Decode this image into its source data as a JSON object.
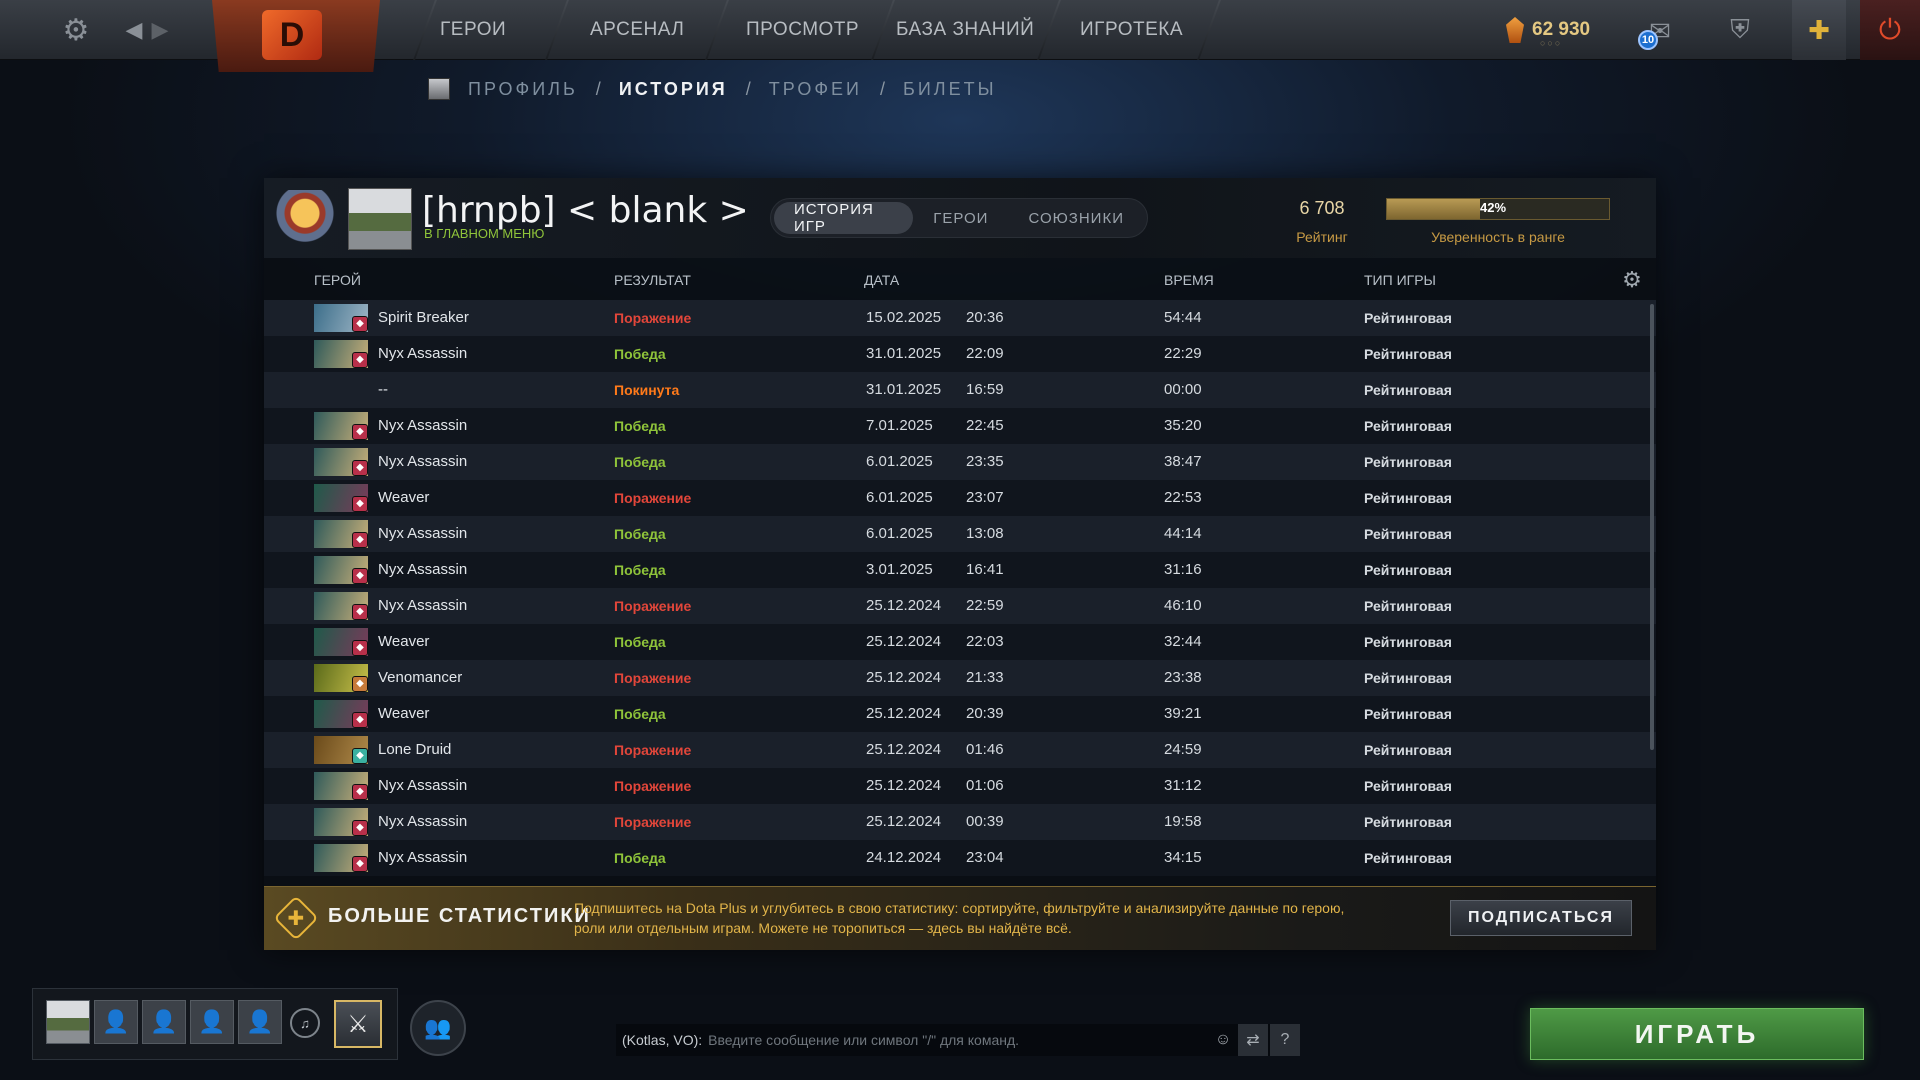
{
  "nav": {
    "items": [
      "ГЕРОИ",
      "АРСЕНАЛ",
      "ПРОСМОТР",
      "БАЗА ЗНАНИЙ",
      "ИГРОТЕКА"
    ],
    "logo_text": "D",
    "shards": "62 930",
    "shard_dots": "○○○",
    "mail_count": "10"
  },
  "subnav": {
    "items": [
      {
        "label": "ПРОФИЛЬ",
        "active": false
      },
      {
        "label": "ИСТОРИЯ",
        "active": true
      },
      {
        "label": "ТРОФЕИ",
        "active": false
      },
      {
        "label": "БИЛЕТЫ",
        "active": false
      }
    ],
    "separator": "/"
  },
  "profile": {
    "name": "[hrnpb] < blank >",
    "status": "В ГЛАВНОМ МЕНЮ",
    "rating_value": "6 708",
    "rating_label": "Рейтинг",
    "confidence_percent": 42,
    "confidence_text": "42%",
    "confidence_label": "Уверенность в ранге"
  },
  "tabs": [
    {
      "label": "ИСТОРИЯ ИГР",
      "active": true
    },
    {
      "label": "ГЕРОИ",
      "active": false
    },
    {
      "label": "СОЮЗНИКИ",
      "active": false
    }
  ],
  "table": {
    "headers": {
      "hero": "ГЕРОЙ",
      "result": "РЕЗУЛЬТАТ",
      "date": "ДАТА",
      "duration": "ВРЕМЯ",
      "mode": "ТИП ИГРЫ"
    },
    "rows": [
      {
        "hero": "Spirit Breaker",
        "result": "Поражение",
        "status": "loss",
        "date": "15.02.2025",
        "time": "20:36",
        "duration": "54:44",
        "mode": "Рейтинговая",
        "colors": [
          "#3c6e8a",
          "#9fb6c6"
        ],
        "role": "#b8304a"
      },
      {
        "hero": "Nyx Assassin",
        "result": "Победа",
        "status": "win",
        "date": "31.01.2025",
        "time": "22:09",
        "duration": "22:29",
        "mode": "Рейтинговая",
        "colors": [
          "#2f5a5a",
          "#c9b07a"
        ],
        "role": "#b8304a"
      },
      {
        "hero": "--",
        "result": "Покинута",
        "status": "abandon",
        "date": "31.01.2025",
        "time": "16:59",
        "duration": "00:00",
        "mode": "Рейтинговая",
        "colors": [],
        "role": ""
      },
      {
        "hero": "Nyx Assassin",
        "result": "Победа",
        "status": "win",
        "date": "7.01.2025",
        "time": "22:45",
        "duration": "35:20",
        "mode": "Рейтинговая",
        "colors": [
          "#2f5a5a",
          "#c9b07a"
        ],
        "role": "#b8304a"
      },
      {
        "hero": "Nyx Assassin",
        "result": "Победа",
        "status": "win",
        "date": "6.01.2025",
        "time": "23:35",
        "duration": "38:47",
        "mode": "Рейтинговая",
        "colors": [
          "#2f5a5a",
          "#c9b07a"
        ],
        "role": "#b8304a"
      },
      {
        "hero": "Weaver",
        "result": "Поражение",
        "status": "loss",
        "date": "6.01.2025",
        "time": "23:07",
        "duration": "22:53",
        "mode": "Рейтинговая",
        "colors": [
          "#1f5a4a",
          "#7a3a5a"
        ],
        "role": "#b8304a"
      },
      {
        "hero": "Nyx Assassin",
        "result": "Победа",
        "status": "win",
        "date": "6.01.2025",
        "time": "13:08",
        "duration": "44:14",
        "mode": "Рейтинговая",
        "colors": [
          "#2f5a5a",
          "#c9b07a"
        ],
        "role": "#b8304a"
      },
      {
        "hero": "Nyx Assassin",
        "result": "Победа",
        "status": "win",
        "date": "3.01.2025",
        "time": "16:41",
        "duration": "31:16",
        "mode": "Рейтинговая",
        "colors": [
          "#2f5a5a",
          "#c9b07a"
        ],
        "role": "#b8304a"
      },
      {
        "hero": "Nyx Assassin",
        "result": "Поражение",
        "status": "loss",
        "date": "25.12.2024",
        "time": "22:59",
        "duration": "46:10",
        "mode": "Рейтинговая",
        "colors": [
          "#2f5a5a",
          "#c9b07a"
        ],
        "role": "#b8304a"
      },
      {
        "hero": "Weaver",
        "result": "Победа",
        "status": "win",
        "date": "25.12.2024",
        "time": "22:03",
        "duration": "32:44",
        "mode": "Рейтинговая",
        "colors": [
          "#1f5a4a",
          "#7a3a5a"
        ],
        "role": "#b8304a"
      },
      {
        "hero": "Venomancer",
        "result": "Поражение",
        "status": "loss",
        "date": "25.12.2024",
        "time": "21:33",
        "duration": "23:38",
        "mode": "Рейтинговая",
        "colors": [
          "#5a6a1a",
          "#c9c04a"
        ],
        "role": "#c77a3a"
      },
      {
        "hero": "Weaver",
        "result": "Победа",
        "status": "win",
        "date": "25.12.2024",
        "time": "20:39",
        "duration": "39:21",
        "mode": "Рейтинговая",
        "colors": [
          "#1f5a4a",
          "#7a3a5a"
        ],
        "role": "#b8304a"
      },
      {
        "hero": "Lone Druid",
        "result": "Поражение",
        "status": "loss",
        "date": "25.12.2024",
        "time": "01:46",
        "duration": "24:59",
        "mode": "Рейтинговая",
        "colors": [
          "#6a4a1a",
          "#b08a4a"
        ],
        "role": "#3ab0a0"
      },
      {
        "hero": "Nyx Assassin",
        "result": "Поражение",
        "status": "loss",
        "date": "25.12.2024",
        "time": "01:06",
        "duration": "31:12",
        "mode": "Рейтинговая",
        "colors": [
          "#2f5a5a",
          "#c9b07a"
        ],
        "role": "#b8304a"
      },
      {
        "hero": "Nyx Assassin",
        "result": "Поражение",
        "status": "loss",
        "date": "25.12.2024",
        "time": "00:39",
        "duration": "19:58",
        "mode": "Рейтинговая",
        "colors": [
          "#2f5a5a",
          "#c9b07a"
        ],
        "role": "#b8304a"
      },
      {
        "hero": "Nyx Assassin",
        "result": "Победа",
        "status": "win",
        "date": "24.12.2024",
        "time": "23:04",
        "duration": "34:15",
        "mode": "Рейтинговая",
        "colors": [
          "#2f5a5a",
          "#c9b07a"
        ],
        "role": "#b8304a"
      }
    ]
  },
  "dota_plus": {
    "title": "БОЛЬШЕ СТАТИСТИКИ",
    "description": "Подпишитесь на Dota Plus и углубитесь в свою статистику: сортируйте, фильтруйте и анализируйте данные по герою, роли или отдельным играм. Можете не торопиться — здесь вы найдёте всё.",
    "subscribe_label": "ПОДПИСАТЬСЯ"
  },
  "chat": {
    "channel": "(Kotlas, VO):",
    "placeholder": "Введите сообщение или символ \"/\" для команд.",
    "help": "?"
  },
  "play_label": "ИГРАТЬ",
  "colors": {
    "win": "#8fc43a",
    "loss": "#e2463a",
    "abandon": "#ff7a1a",
    "gold": "#c79a44",
    "play_green": "#4f9a46"
  }
}
